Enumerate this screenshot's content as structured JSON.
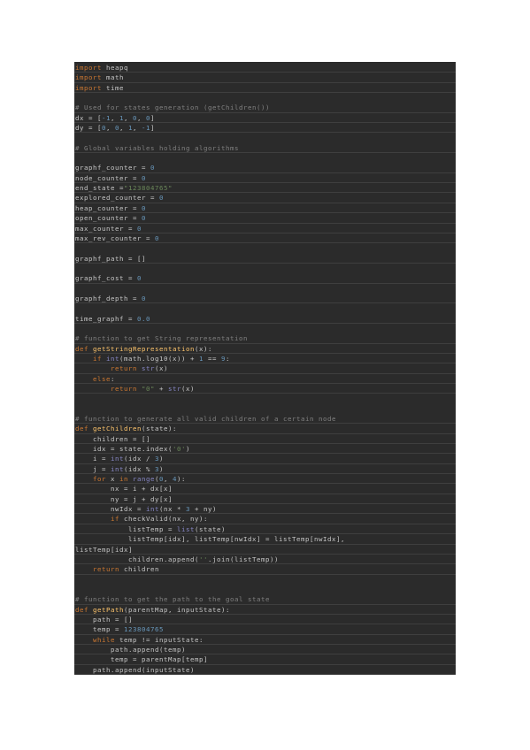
{
  "document": {
    "language": "python",
    "colors": {
      "background": "#2b2b2b",
      "text": "#c8c8c8",
      "keyword": "#cc7832",
      "function_name": "#ffc66d",
      "number": "#6897bb",
      "string": "#6a8759",
      "comment": "#808080",
      "builtin": "#8888c6"
    },
    "lines": [
      [
        [
          "kw",
          "import"
        ],
        [
          "t",
          " heapq"
        ]
      ],
      [
        [
          "kw",
          "import"
        ],
        [
          "t",
          " math"
        ]
      ],
      [
        [
          "kw",
          "import"
        ],
        [
          "t",
          " time"
        ]
      ],
      [],
      [
        [
          "cmt",
          "# Used for states generation (getChildren())"
        ]
      ],
      [
        [
          "t",
          "dx = ["
        ],
        [
          "num",
          "-1"
        ],
        [
          "t",
          ", "
        ],
        [
          "num",
          "1"
        ],
        [
          "t",
          ", "
        ],
        [
          "num",
          "0"
        ],
        [
          "t",
          ", "
        ],
        [
          "num",
          "0"
        ],
        [
          "t",
          "]"
        ]
      ],
      [
        [
          "t",
          "dy = ["
        ],
        [
          "num",
          "0"
        ],
        [
          "t",
          ", "
        ],
        [
          "num",
          "0"
        ],
        [
          "t",
          ", "
        ],
        [
          "num",
          "1"
        ],
        [
          "t",
          ", "
        ],
        [
          "num",
          "-1"
        ],
        [
          "t",
          "]"
        ]
      ],
      [],
      [
        [
          "cmt",
          "# Global variables holding algorithms"
        ]
      ],
      [],
      [
        [
          "t",
          "graphf_counter = "
        ],
        [
          "num",
          "0"
        ]
      ],
      [
        [
          "t",
          "node_counter = "
        ],
        [
          "num",
          "0"
        ]
      ],
      [
        [
          "t",
          "end_state ="
        ],
        [
          "str",
          "\"123804765\""
        ]
      ],
      [
        [
          "t",
          "explored_counter = "
        ],
        [
          "num",
          "0"
        ]
      ],
      [
        [
          "t",
          "heap_counter = "
        ],
        [
          "num",
          "0"
        ]
      ],
      [
        [
          "t",
          "open_counter = "
        ],
        [
          "num",
          "0"
        ]
      ],
      [
        [
          "t",
          "max_counter = "
        ],
        [
          "num",
          "0"
        ]
      ],
      [
        [
          "t",
          "max_rev_counter = "
        ],
        [
          "num",
          "0"
        ]
      ],
      [],
      [
        [
          "t",
          "graphf_path = []"
        ]
      ],
      [],
      [
        [
          "t",
          "graphf_cost = "
        ],
        [
          "num",
          "0"
        ]
      ],
      [],
      [
        [
          "t",
          "graphf_depth = "
        ],
        [
          "num",
          "0"
        ]
      ],
      [],
      [
        [
          "t",
          "time_graphf = "
        ],
        [
          "num",
          "0.0"
        ]
      ],
      [],
      [
        [
          "cmt",
          "# function to get String representation"
        ]
      ],
      [
        [
          "kw",
          "def "
        ],
        [
          "fn",
          "getStringRepresentation"
        ],
        [
          "t",
          "(x):"
        ]
      ],
      [
        [
          "t",
          "    "
        ],
        [
          "kw",
          "if "
        ],
        [
          "bi",
          "int"
        ],
        [
          "t",
          "(math.log10(x)) + "
        ],
        [
          "num",
          "1"
        ],
        [
          "t",
          " == "
        ],
        [
          "num",
          "9"
        ],
        [
          "t",
          ":"
        ]
      ],
      [
        [
          "t",
          "        "
        ],
        [
          "kw",
          "return "
        ],
        [
          "bi",
          "str"
        ],
        [
          "t",
          "(x)"
        ]
      ],
      [
        [
          "t",
          "    "
        ],
        [
          "kw",
          "else"
        ],
        [
          "t",
          ":"
        ]
      ],
      [
        [
          "t",
          "        "
        ],
        [
          "kw",
          "return "
        ],
        [
          "str",
          "\"0\""
        ],
        [
          "t",
          " + "
        ],
        [
          "bi",
          "str"
        ],
        [
          "t",
          "(x)"
        ]
      ],
      [],
      [],
      [
        [
          "cmt",
          "# function to generate all valid children of a certain node"
        ]
      ],
      [
        [
          "kw",
          "def "
        ],
        [
          "fn",
          "getChildren"
        ],
        [
          "t",
          "(state):"
        ]
      ],
      [
        [
          "t",
          "    children = []"
        ]
      ],
      [
        [
          "t",
          "    idx = state.index("
        ],
        [
          "str",
          "'0'"
        ],
        [
          "t",
          ")"
        ]
      ],
      [
        [
          "t",
          "    i = "
        ],
        [
          "bi",
          "int"
        ],
        [
          "t",
          "(idx / "
        ],
        [
          "num",
          "3"
        ],
        [
          "t",
          ")"
        ]
      ],
      [
        [
          "t",
          "    j = "
        ],
        [
          "bi",
          "int"
        ],
        [
          "t",
          "(idx % "
        ],
        [
          "num",
          "3"
        ],
        [
          "t",
          ")"
        ]
      ],
      [
        [
          "t",
          "    "
        ],
        [
          "kw",
          "for "
        ],
        [
          "t",
          "x "
        ],
        [
          "kw",
          "in "
        ],
        [
          "bi",
          "range"
        ],
        [
          "t",
          "("
        ],
        [
          "num",
          "0"
        ],
        [
          "t",
          ", "
        ],
        [
          "num",
          "4"
        ],
        [
          "t",
          "):"
        ]
      ],
      [
        [
          "t",
          "        nx = i + dx[x]"
        ]
      ],
      [
        [
          "t",
          "        ny = j + dy[x]"
        ]
      ],
      [
        [
          "t",
          "        nwIdx = "
        ],
        [
          "bi",
          "int"
        ],
        [
          "t",
          "(nx * "
        ],
        [
          "num",
          "3"
        ],
        [
          "t",
          " + ny)"
        ]
      ],
      [
        [
          "t",
          "        "
        ],
        [
          "kw",
          "if "
        ],
        [
          "t",
          "checkValid(nx, ny):"
        ]
      ],
      [
        [
          "t",
          "            listTemp = "
        ],
        [
          "bi",
          "list"
        ],
        [
          "t",
          "(state)"
        ]
      ],
      [
        [
          "t",
          "            listTemp[idx], listTemp[nwIdx] = listTemp[nwIdx],"
        ]
      ],
      [
        [
          "t",
          "listTemp[idx]"
        ]
      ],
      [
        [
          "t",
          "            children.append("
        ],
        [
          "str",
          "''"
        ],
        [
          "t",
          ".join(listTemp))"
        ]
      ],
      [
        [
          "t",
          "    "
        ],
        [
          "kw",
          "return "
        ],
        [
          "t",
          "children"
        ]
      ],
      [],
      [],
      [
        [
          "cmt",
          "# function to get the path to the goal state"
        ]
      ],
      [
        [
          "kw",
          "def "
        ],
        [
          "fn",
          "getPath"
        ],
        [
          "t",
          "(parentMap, inputState):"
        ]
      ],
      [
        [
          "t",
          "    path = []"
        ]
      ],
      [
        [
          "t",
          "    temp = "
        ],
        [
          "num",
          "123804765"
        ]
      ],
      [
        [
          "t",
          "    "
        ],
        [
          "kw",
          "while "
        ],
        [
          "t",
          "temp != inputState:"
        ]
      ],
      [
        [
          "t",
          "        path.append(temp)"
        ]
      ],
      [
        [
          "t",
          "        temp = parentMap[temp]"
        ]
      ],
      [
        [
          "t",
          "    path.append(inputState)"
        ]
      ]
    ]
  }
}
